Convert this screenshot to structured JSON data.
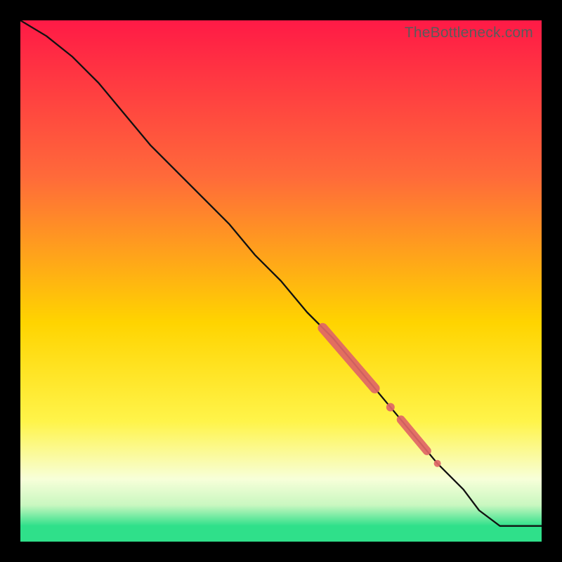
{
  "attribution": "TheBottleneck.com",
  "colors": {
    "top": "#ff1a46",
    "mid1": "#ff6a3a",
    "mid2": "#ffd400",
    "mid3": "#fff44a",
    "pale": "#f7ffd9",
    "green": "#2fe08a",
    "line": "#111111",
    "marker": "#e06666",
    "frame": "#000000"
  },
  "chart_data": {
    "type": "line",
    "title": "",
    "xlabel": "",
    "ylabel": "",
    "xlim": [
      0,
      100
    ],
    "ylim": [
      0,
      100
    ],
    "series": [
      {
        "name": "curve",
        "x": [
          0,
          5,
          10,
          15,
          20,
          25,
          30,
          35,
          40,
          45,
          50,
          55,
          60,
          65,
          70,
          75,
          80,
          85,
          88,
          92,
          100
        ],
        "y": [
          100,
          97,
          93,
          88,
          82,
          76,
          71,
          66,
          61,
          55,
          50,
          44,
          39,
          33,
          27,
          21,
          15,
          10,
          6,
          3,
          3
        ]
      }
    ],
    "markers": [
      {
        "name": "cluster-a",
        "x_range": [
          58,
          68
        ],
        "y_range": [
          42,
          31
        ],
        "weight": 7
      },
      {
        "name": "dot-1",
        "x": 71,
        "y": 28,
        "weight": 5
      },
      {
        "name": "cluster-b",
        "x_range": [
          73,
          78
        ],
        "y_range": [
          25,
          20
        ],
        "weight": 6
      },
      {
        "name": "dot-2",
        "x": 80,
        "y": 17,
        "weight": 4
      }
    ],
    "gradient_stops": [
      {
        "offset": 0.0,
        "color": "#ff1a46"
      },
      {
        "offset": 0.3,
        "color": "#ff6a3a"
      },
      {
        "offset": 0.58,
        "color": "#ffd400"
      },
      {
        "offset": 0.77,
        "color": "#fff44a"
      },
      {
        "offset": 0.88,
        "color": "#f7ffd9"
      },
      {
        "offset": 0.93,
        "color": "#c9f7c0"
      },
      {
        "offset": 0.97,
        "color": "#2fe08a"
      },
      {
        "offset": 1.0,
        "color": "#2fe08a"
      }
    ]
  }
}
